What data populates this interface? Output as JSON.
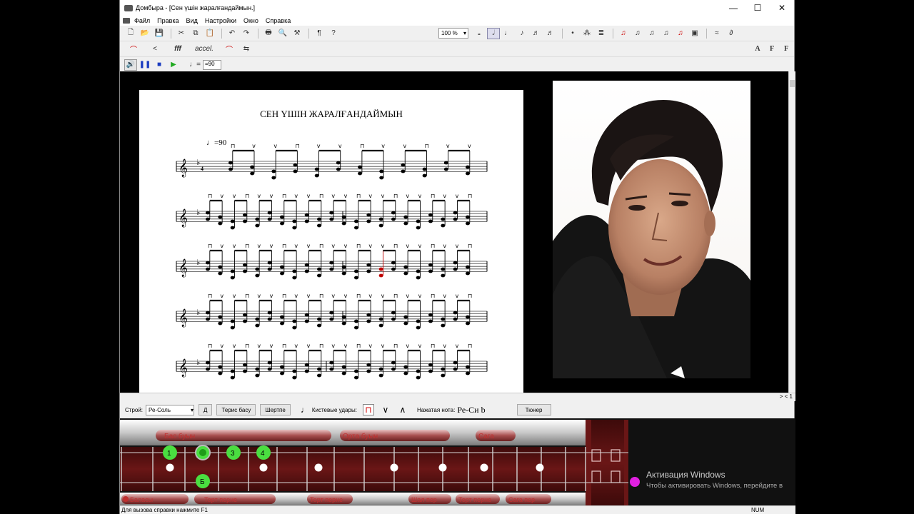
{
  "window": {
    "title": "Домбыра - [Сен үшін жаралғандаймын.]",
    "controls": [
      "—",
      "☐",
      "✕"
    ]
  },
  "menu": [
    "Файл",
    "Правка",
    "Вид",
    "Настройки",
    "Окно",
    "Справка"
  ],
  "toolbar": {
    "zoom": "100 %"
  },
  "score": {
    "title": "СЕН ҮШІН ЖАРАЛҒАНДАЙМЫН",
    "tempo": "=90",
    "systems": 5
  },
  "bottom": {
    "tuning_label": "Строй:",
    "tuning_value": "Ре-Соль",
    "d_button": "Д",
    "reverse_bass": "Терис басу",
    "shertpe": "Шертпе",
    "strokes_label": "Кистевые удары:",
    "pressed_note_label": "Нажатая нота:",
    "pressed_note_value": "Ре-Си b",
    "tuner": "Тюнер"
  },
  "neck": {
    "top_labels": [
      "Бас буын",
      "Орта буын",
      "Сага"
    ],
    "bottom_labels": [
      "Баласы",
      "Торт перне",
      "Торт перне",
      "Шал пер",
      "Торт перне",
      "Сага пер"
    ],
    "finger_marks": [
      "1",
      "2",
      "3",
      "4"
    ],
    "open_mark": "Б"
  },
  "status": {
    "help": "Для вызова справки нажмите F1",
    "num": "NUM"
  },
  "page_indicator": "> <  1",
  "activation": {
    "title": "Активация Windows",
    "subtitle": "Чтобы активировать Windows, перейдите в"
  },
  "colors": {
    "neck_wood": "#5a1010",
    "marker_green": "#4ade40",
    "stroke_red": "#d40000",
    "highlight_note": "#c00000"
  }
}
